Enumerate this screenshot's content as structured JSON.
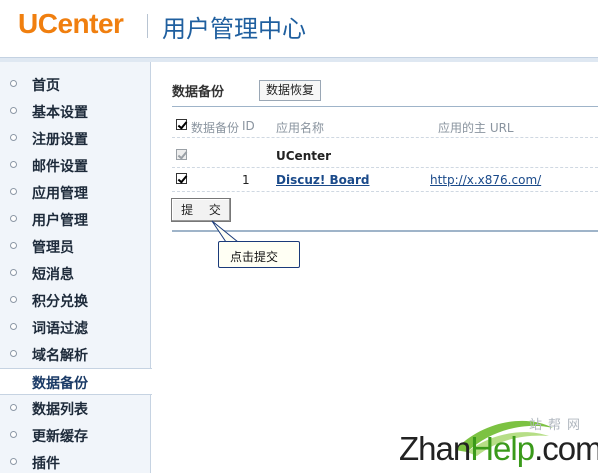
{
  "header": {
    "logo": "UCenter",
    "title": "用户管理中心"
  },
  "sidebar": {
    "items": [
      {
        "label": "首页"
      },
      {
        "label": "基本设置"
      },
      {
        "label": "注册设置"
      },
      {
        "label": "邮件设置"
      },
      {
        "label": "应用管理"
      },
      {
        "label": "用户管理"
      },
      {
        "label": "管理员"
      },
      {
        "label": "短消息"
      },
      {
        "label": "积分兑换"
      },
      {
        "label": "词语过滤"
      },
      {
        "label": "域名解析"
      },
      {
        "label": "数据备份",
        "active": true
      },
      {
        "label": "数据列表"
      },
      {
        "label": "更新缓存"
      },
      {
        "label": "插件"
      }
    ]
  },
  "main": {
    "section_title": "数据备份",
    "restore_button": "数据恢复",
    "table": {
      "headers": {
        "select": "数据备份",
        "id": "ID",
        "name": "应用名称",
        "url": "应用的主 URL"
      },
      "rows": [
        {
          "checked": true,
          "disabled": true,
          "id": "",
          "name": "UCenter",
          "url": ""
        },
        {
          "checked": true,
          "disabled": false,
          "id": "1",
          "name": "Discuz! Board",
          "url": "http://x.x876.com/"
        }
      ]
    },
    "submit_button": "提 交",
    "callout": "点击提交"
  },
  "watermark": {
    "sub": "站帮网",
    "main_prefix": "Zhan",
    "main_green": "Help",
    "main_suffix": ".com"
  },
  "colors": {
    "logo_orange": "#f07f0f",
    "title_blue": "#1f5f9f",
    "sidebar_bg": "#f1f5fa",
    "watermark_green": "#3a9a1a"
  }
}
